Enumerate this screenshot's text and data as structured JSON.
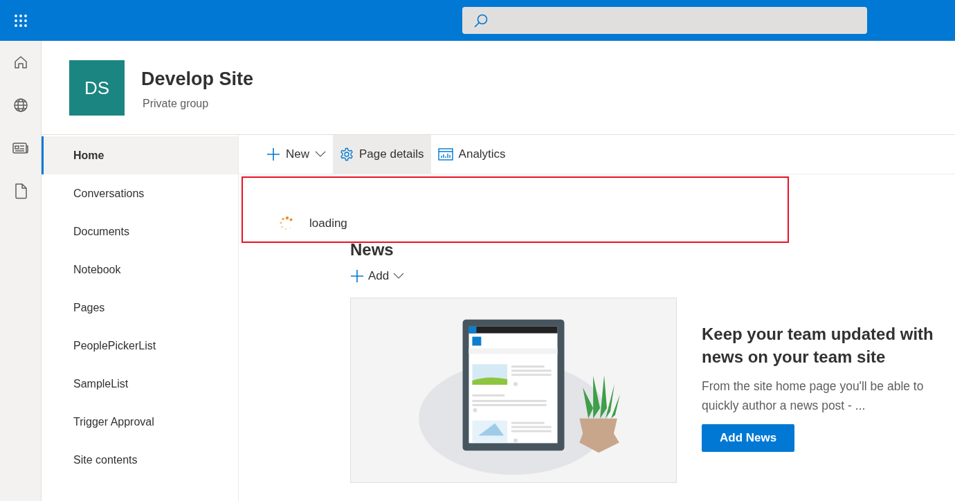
{
  "site": {
    "logo_text": "DS",
    "title": "Develop Site",
    "subtitle": "Private group"
  },
  "nav": [
    {
      "label": "Home",
      "selected": true
    },
    {
      "label": "Conversations",
      "selected": false
    },
    {
      "label": "Documents",
      "selected": false
    },
    {
      "label": "Notebook",
      "selected": false
    },
    {
      "label": "Pages",
      "selected": false
    },
    {
      "label": "PeoplePickerList",
      "selected": false
    },
    {
      "label": "SampleList",
      "selected": false
    },
    {
      "label": "Trigger Approval",
      "selected": false
    },
    {
      "label": "Site contents",
      "selected": false
    }
  ],
  "commands": [
    {
      "kind": "new",
      "label": "New",
      "highlighted": false
    },
    {
      "kind": "details",
      "label": "Page details",
      "highlighted": true
    },
    {
      "kind": "analytics",
      "label": "Analytics",
      "highlighted": false
    }
  ],
  "loading": {
    "text": "loading"
  },
  "news": {
    "title": "News",
    "add_label": "Add",
    "promo_title": "Keep your team updated with news on your team site",
    "promo_text": "From the site home page you'll be able to quickly author a news post - ...",
    "button": "Add News"
  }
}
